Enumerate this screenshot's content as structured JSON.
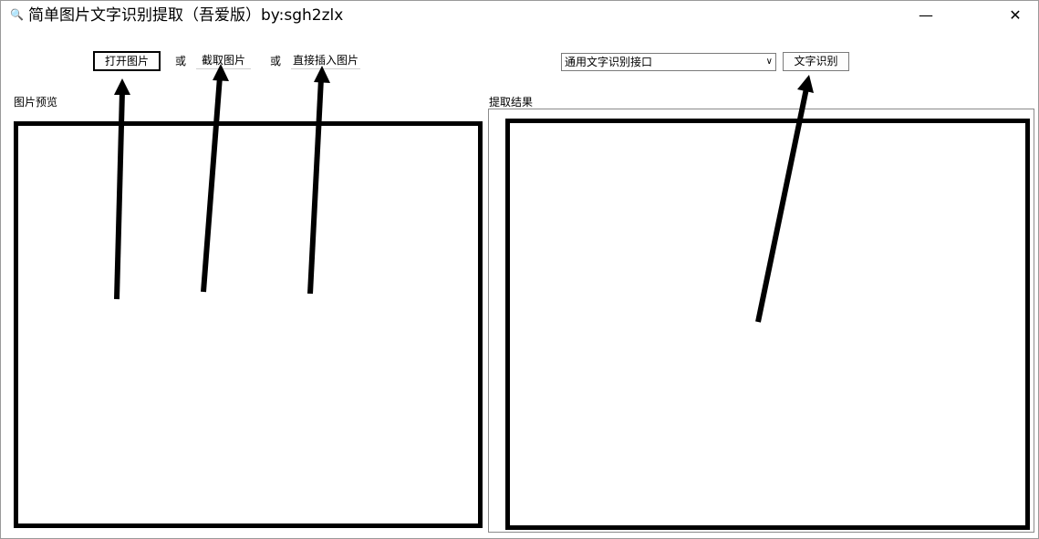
{
  "window": {
    "title": "简单图片文字识别提取（吾爱版）by:sgh2zlx",
    "app_icon": "magnifier-icon",
    "minimize_glyph": "—",
    "close_glyph": "✕"
  },
  "toolbar": {
    "open_label": "打开图片",
    "or_label_1": "或",
    "capture_label": "截取图片",
    "or_label_2": "或",
    "paste_label": "直接插入图片",
    "api_select_value": "通用文字识别接口",
    "ocr_label": "文字识别"
  },
  "panels": {
    "preview_label": "图片预览",
    "result_label": "提取结果",
    "result_text": ""
  }
}
